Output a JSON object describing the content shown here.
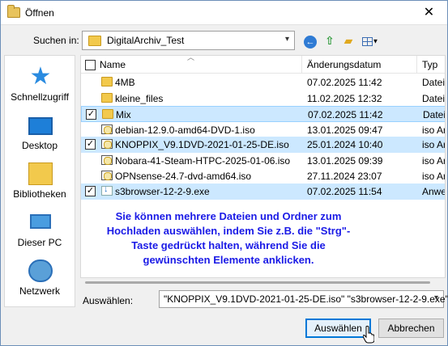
{
  "window": {
    "title": "Öffnen",
    "close_glyph": "✕"
  },
  "toolbar": {
    "lookin_label": "Suchen in:",
    "lookin_value": "DigitalArchiv_Test",
    "back_icon": "back-arrow-icon",
    "up_icon": "up-folder-icon",
    "newfolder_icon": "new-folder-icon",
    "view_icon": "view-menu-icon"
  },
  "places": [
    {
      "label": "Schnellzugriff",
      "icon": "quick-access-star-icon"
    },
    {
      "label": "Desktop",
      "icon": "desktop-icon"
    },
    {
      "label": "Bibliotheken",
      "icon": "libraries-icon"
    },
    {
      "label": "Dieser PC",
      "icon": "this-pc-icon"
    },
    {
      "label": "Netzwerk",
      "icon": "network-icon"
    }
  ],
  "columns": {
    "name": "Name",
    "date": "Änderungsdatum",
    "type": "Typ"
  },
  "files": [
    {
      "name": "4MB",
      "date": "07.02.2025 11:42",
      "type": "Dateio",
      "kind": "folder",
      "checked": false,
      "selected": false
    },
    {
      "name": "kleine_files",
      "date": "11.02.2025 12:32",
      "type": "Dateio",
      "kind": "folder",
      "checked": false,
      "selected": false
    },
    {
      "name": "Mix",
      "date": "07.02.2025 11:42",
      "type": "Dateio",
      "kind": "folder",
      "checked": true,
      "selected": true
    },
    {
      "name": "debian-12.9.0-amd64-DVD-1.iso",
      "date": "13.01.2025 09:47",
      "type": "iso Ar",
      "kind": "iso",
      "checked": false,
      "selected": false
    },
    {
      "name": "KNOPPIX_V9.1DVD-2021-01-25-DE.iso",
      "date": "25.01.2024 10:40",
      "type": "iso Ar",
      "kind": "iso",
      "checked": true,
      "selected": true
    },
    {
      "name": "Nobara-41-Steam-HTPC-2025-01-06.iso",
      "date": "13.01.2025 09:39",
      "type": "iso Ar",
      "kind": "iso",
      "checked": false,
      "selected": false
    },
    {
      "name": "OPNsense-24.7-dvd-amd64.iso",
      "date": "27.11.2024 23:07",
      "type": "iso Ar",
      "kind": "iso",
      "checked": false,
      "selected": false
    },
    {
      "name": "s3browser-12-2-9.exe",
      "date": "07.02.2025 11:54",
      "type": "Anwe",
      "kind": "exe",
      "checked": true,
      "selected": true
    }
  ],
  "hint_text": "Sie können mehrere Dateien und Ordner zum Hochladen auswählen, indem Sie z.B. die \"Strg\"-Taste gedrückt halten, während Sie die gewünschten Elemente anklicken.",
  "selection": {
    "label": "Auswählen:",
    "value": "\"KNOPPIX_V9.1DVD-2021-01-25-DE.iso\" \"s3browser-12-2-9.exe\""
  },
  "buttons": {
    "open": "Auswählen",
    "cancel": "Abbrechen"
  },
  "colors": {
    "hint": "#1a1ae6",
    "selection_bg": "#cce8ff",
    "default_button_border": "#0078d7"
  }
}
